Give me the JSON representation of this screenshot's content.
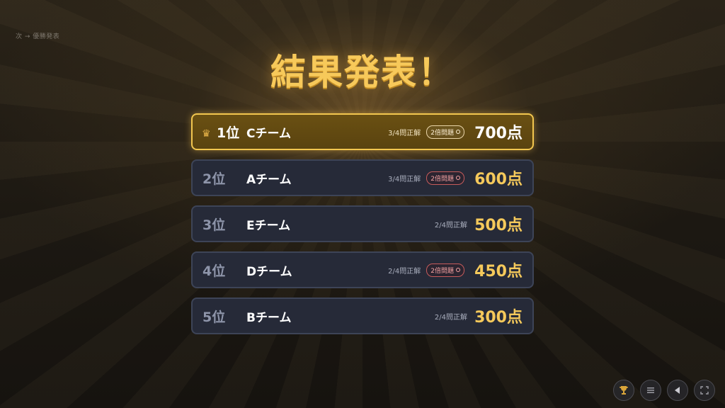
{
  "breadcrumb": "次 → 優勝発表",
  "title": "結果発表！",
  "ranking": [
    {
      "rank": "1位",
      "team": "Cチーム",
      "correct": "3/4問正解",
      "badge": "2倍問題",
      "score": "700点"
    },
    {
      "rank": "2位",
      "team": "Aチーム",
      "correct": "3/4問正解",
      "badge": "2倍問題",
      "score": "600点"
    },
    {
      "rank": "3位",
      "team": "Eチーム",
      "correct": "2/4問正解",
      "badge": "",
      "score": "500点"
    },
    {
      "rank": "4位",
      "team": "Dチーム",
      "correct": "2/4問正解",
      "badge": "2倍問題",
      "score": "450点"
    },
    {
      "rank": "5位",
      "team": "Bチーム",
      "correct": "2/4問正解",
      "badge": "",
      "score": "300点"
    }
  ],
  "controls": {
    "trophy_icon": "trophy-icon",
    "menu_icon": "menu-icon",
    "back_icon": "back-icon",
    "fullscreen_icon": "fullscreen-icon"
  },
  "colors": {
    "accent": "#f5c95b",
    "first_border": "#f2c64f",
    "badge": "#f7a3a3"
  }
}
